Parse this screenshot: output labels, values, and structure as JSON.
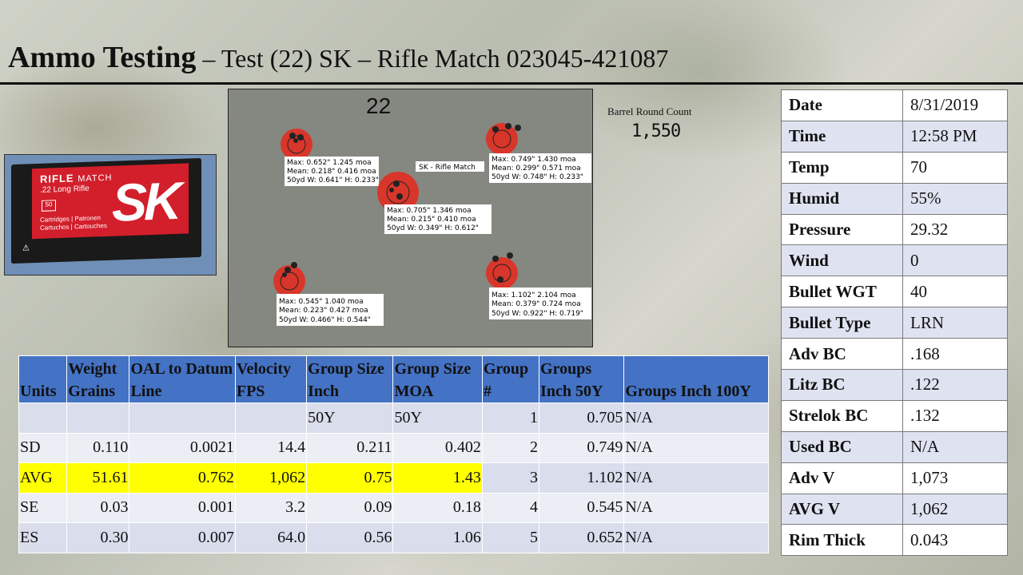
{
  "header": {
    "title_main": "Ammo Testing",
    "title_rest": " – Test (22) SK – Rifle Match 023045-421087"
  },
  "ammo_box": {
    "brand_line": "RIFLE",
    "brand_line2": "MATCH",
    "caliber": ".22 Long Rifle",
    "count": "50",
    "cartridges": [
      "Cartridges | Patronen",
      "Cartuchos | Cartouches"
    ],
    "logo": "SK"
  },
  "round_count": {
    "label": "Barrel Round Count",
    "value": "1,550"
  },
  "target": {
    "handwritten": "22",
    "center_label": "SK - Rifle Match",
    "groups": [
      {
        "lines": [
          "Max: 0.652\" 1.245 moa",
          "Mean: 0.218\" 0.416 moa",
          "50yd  W: 0.641\" H: 0.233\""
        ]
      },
      {
        "lines": [
          "Max: 0.749\" 1.430 moa",
          "Mean: 0.299\" 0.571 moa",
          "50yd  W: 0.748\" H: 0.233\""
        ]
      },
      {
        "lines": [
          "Max: 0.705\" 1.346 moa",
          "Mean: 0.215\" 0.410 moa",
          "50yd  W: 0.349\" H: 0.612\""
        ]
      },
      {
        "lines": [
          "Max: 0.545\" 1.040 moa",
          "Mean: 0.223\" 0.427 moa",
          "50yd  W: 0.466\" H: 0.544\""
        ]
      },
      {
        "lines": [
          "Max: 1.102\" 2.104 moa",
          "Mean: 0.379\" 0.724 moa",
          "50yd  W: 0.922\" H: 0.719\""
        ]
      }
    ]
  },
  "conditions": [
    {
      "key": "Date",
      "value": "8/31/2019"
    },
    {
      "key": "Time",
      "value": "12:58 PM"
    },
    {
      "key": "Temp",
      "value": "70"
    },
    {
      "key": "Humid",
      "value": "55%"
    },
    {
      "key": "Pressure",
      "value": "29.32"
    },
    {
      "key": "Wind",
      "value": "0"
    },
    {
      "key": "Bullet WGT",
      "value": "40"
    },
    {
      "key": "Bullet Type",
      "value": "LRN"
    },
    {
      "key": "Adv BC",
      "value": ".168"
    },
    {
      "key": "Litz BC",
      "value": ".122"
    },
    {
      "key": "Strelok BC",
      "value": ".132"
    },
    {
      "key": "Used BC",
      "value": "N/A"
    },
    {
      "key": "Adv V",
      "value": "1,073"
    },
    {
      "key": "AVG V",
      "value": "1,062"
    },
    {
      "key": "Rim Thick",
      "value": "0.043"
    }
  ],
  "stats": {
    "headers": [
      "Units",
      "Weight Grains",
      "OAL to Datum Line",
      "Velocity FPS",
      "Group Size Inch",
      "Group Size MOA",
      "Group #",
      "Groups Inch 50Y",
      "Groups  Inch 100Y"
    ],
    "rows": [
      [
        "",
        "",
        "",
        "",
        "50Y",
        "50Y",
        "1",
        "0.705",
        "N/A"
      ],
      [
        "SD",
        "0.110",
        "0.0021",
        "14.4",
        "0.211",
        "0.402",
        "2",
        "0.749",
        "N/A"
      ],
      [
        "AVG",
        "51.61",
        "0.762",
        "1,062",
        "0.75",
        "1.43",
        "3",
        "1.102",
        "N/A"
      ],
      [
        "SE",
        "0.03",
        "0.001",
        "3.2",
        "0.09",
        "0.18",
        "4",
        "0.545",
        "N/A"
      ],
      [
        "ES",
        "0.30",
        "0.007",
        "64.0",
        "0.56",
        "1.06",
        "5",
        "0.652",
        "N/A"
      ]
    ],
    "highlight_color": "#ffff00",
    "header_color": "#4472c4"
  }
}
